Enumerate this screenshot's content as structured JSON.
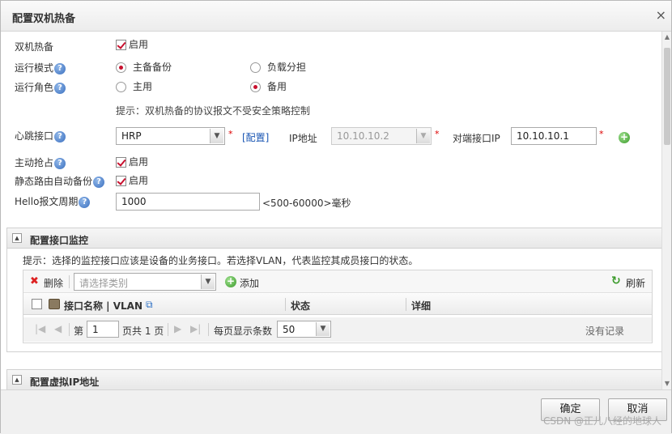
{
  "dialog": {
    "title": "配置双机热备",
    "close_glyph": "×"
  },
  "form": {
    "ha_label": "双机热备",
    "ha_enable_text": "启用",
    "mode_label": "运行模式",
    "mode_opt_primary": "主备备份",
    "mode_opt_lb": "负载分担",
    "role_label": "运行角色",
    "role_opt_main": "主用",
    "role_opt_backup": "备用",
    "tip_text": "提示：双机热备的协议报文不受安全策略控制",
    "heartbeat_label": "心跳接口",
    "heartbeat_value": "HRP",
    "config_link": "[配置]",
    "ip_label": "IP地址",
    "ip_value": "10.10.10.2",
    "peer_label": "对端接口IP",
    "peer_value": "10.10.10.1",
    "preempt_label": "主动抢占",
    "preempt_text": "启用",
    "static_label": "静态路由自动备份",
    "static_text": "启用",
    "hello_label": "Hello报文周期",
    "hello_value": "1000",
    "hello_range": "<500-60000>毫秒",
    "help_glyph": "?",
    "required_mark": "*"
  },
  "monitor": {
    "section_title": "配置接口监控",
    "tip": "提示：选择的监控接口应该是设备的业务接口。若选择VLAN，代表监控其成员接口的状态。",
    "delete_label": "删除",
    "category_placeholder": "请选择类别",
    "add_label": "添加",
    "refresh_label": "刷新",
    "col_name": "接口名称 | VLAN",
    "col_status": "状态",
    "col_detail": "详细",
    "pager_page_prefix": "第",
    "pager_page_value": "1",
    "pager_total": "页共 1 页",
    "pager_per_page": "每页显示条数",
    "pager_size": "50",
    "no_records": "没有记录"
  },
  "vip": {
    "section_title": "配置虚拟IP地址"
  },
  "footer": {
    "ok_label": "确定",
    "cancel_label": "取消"
  },
  "watermark": "CSDN @正儿八经的地球人",
  "colors": {
    "accent_red": "#c8102e",
    "link_blue": "#1a56b3",
    "add_green": "#3a9a2a"
  }
}
